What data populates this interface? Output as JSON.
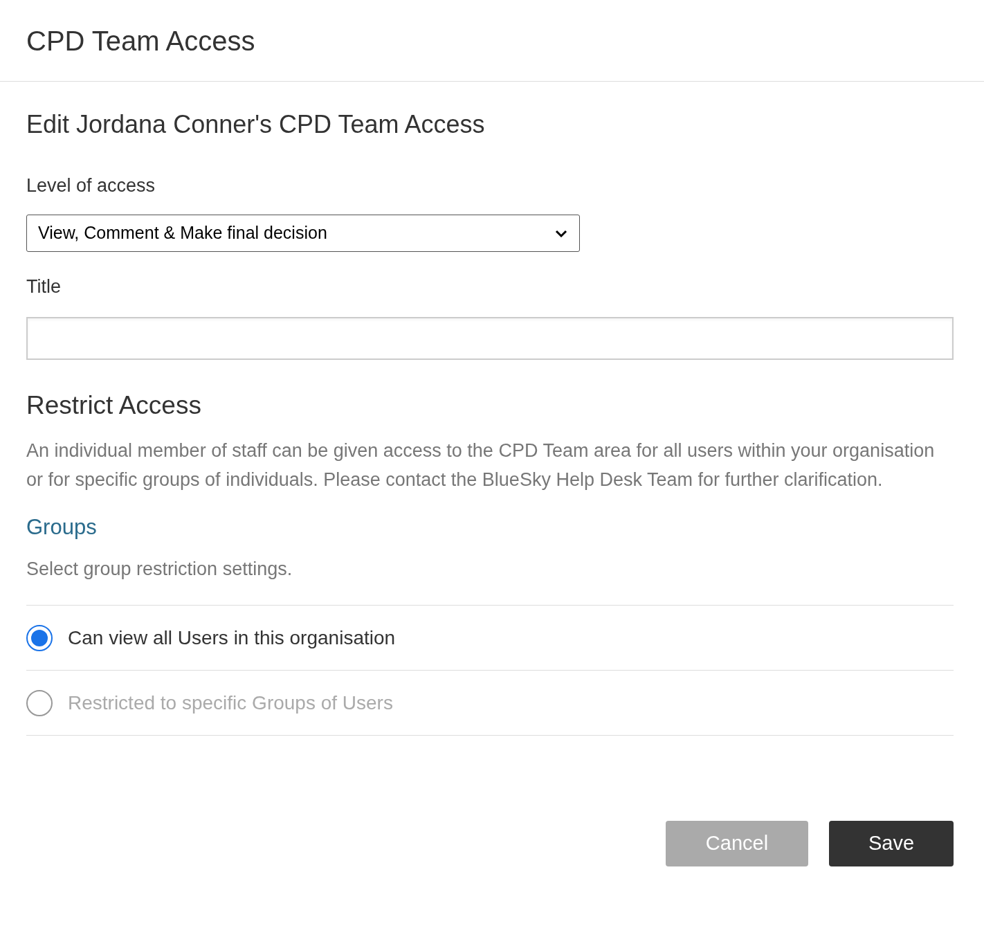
{
  "header": {
    "title": "CPD Team Access"
  },
  "heading": "Edit Jordana Conner's CPD Team Access",
  "access_level": {
    "label": "Level of access",
    "value": "View, Comment & Make final decision"
  },
  "title_field": {
    "label": "Title"
  },
  "restrict": {
    "heading": "Restrict Access",
    "description": "An individual member of staff can be given access to the CPD Team area for all users within your organisation or for specific groups of individuals. Please contact the BlueSky Help Desk Team for further clarification."
  },
  "groups": {
    "heading": "Groups",
    "hint": "Select group restriction settings.",
    "options": [
      {
        "label": "Can view all Users in this organisation",
        "selected": true,
        "disabled": false
      },
      {
        "label": "Restricted to specific Groups of Users",
        "selected": false,
        "disabled": true
      }
    ]
  },
  "buttons": [
    {
      "label": "Cancel",
      "kind": "secondary"
    },
    {
      "label": "Save",
      "kind": "primary"
    }
  ]
}
